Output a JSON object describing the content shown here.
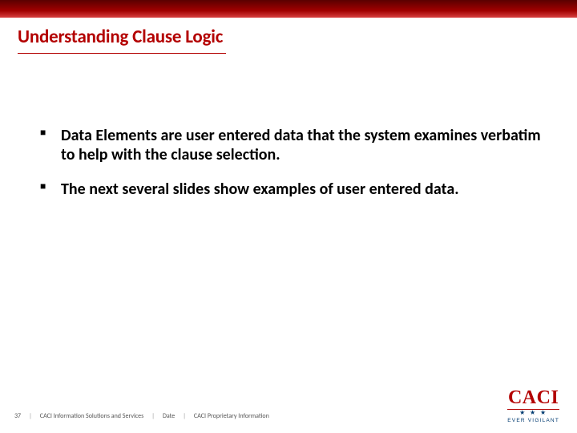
{
  "title": "Understanding Clause Logic",
  "bullets": [
    "Data Elements are user entered data that the system examines verbatim to help with the clause selection.",
    "The next several slides show examples of user entered data."
  ],
  "footer": {
    "page_number": "37",
    "org": "CACI Information Solutions and Services",
    "date_label": "Date",
    "classification": "CACI Proprietary Information"
  },
  "logo": {
    "name": "CACI",
    "tagline": "EVER VIGILANT"
  }
}
